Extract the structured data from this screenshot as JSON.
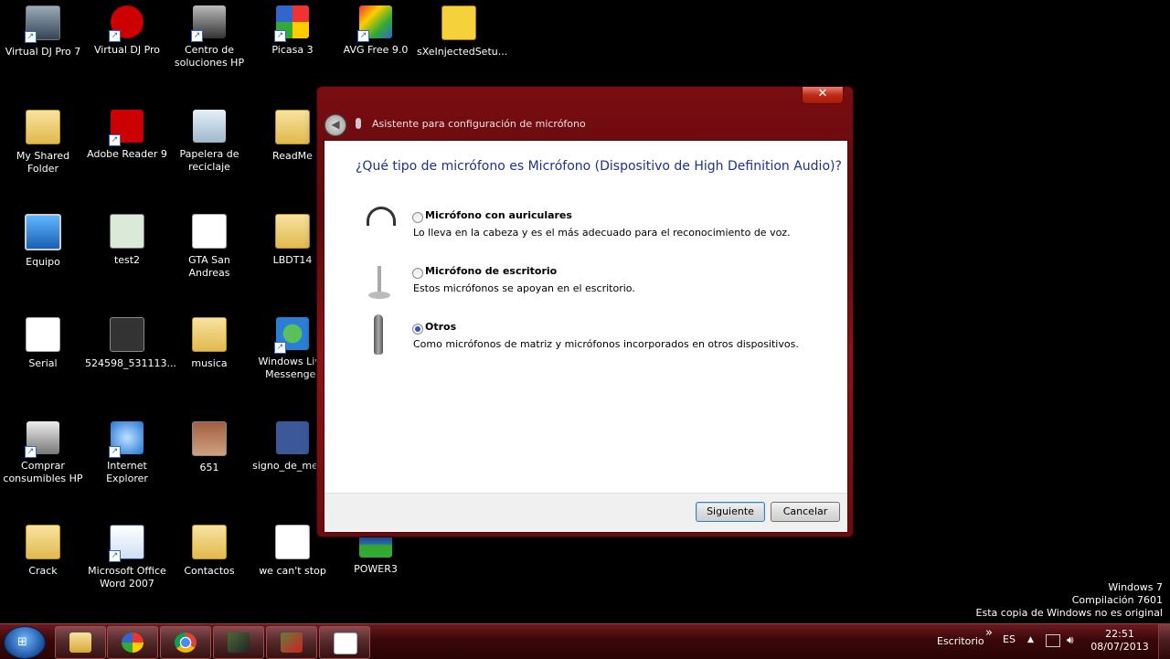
{
  "desktop": {
    "icons": [
      {
        "label": "Virtual DJ Pro 7",
        "icon": "virtual-dj-icon"
      },
      {
        "label": "Virtual DJ Pro",
        "icon": "virtual-dj-icon"
      },
      {
        "label": "Centro de soluciones HP",
        "icon": "hp-icon"
      },
      {
        "label": "Picasa 3",
        "icon": "picasa-icon"
      },
      {
        "label": "AVG Free 9.0",
        "icon": "avg-icon"
      },
      {
        "label": "sXeInjectedSetu...",
        "icon": "sxe-icon"
      },
      {
        "label": "My Shared Folder",
        "icon": "folder-icon"
      },
      {
        "label": "Adobe Reader 9",
        "icon": "adobe-reader-icon"
      },
      {
        "label": "Papelera de reciclaje",
        "icon": "recycle-bin-icon"
      },
      {
        "label": "ReadMe",
        "icon": "folder-icon"
      },
      {
        "label": "Equipo",
        "icon": "computer-icon"
      },
      {
        "label": "test2",
        "icon": "app-icon"
      },
      {
        "label": "GTA San Andreas",
        "icon": "document-icon"
      },
      {
        "label": "LBDT14",
        "icon": "folder-icon"
      },
      {
        "label": "Serial",
        "icon": "text-file-icon"
      },
      {
        "label": "524598_531113...",
        "icon": "photo-icon"
      },
      {
        "label": "musica",
        "icon": "folder-icon"
      },
      {
        "label": "Windows Live Messenger",
        "icon": "messenger-icon"
      },
      {
        "label": "Comprar consumibles HP",
        "icon": "printer-icon"
      },
      {
        "label": "Internet Explorer",
        "icon": "internet-explorer-icon"
      },
      {
        "label": "651",
        "icon": "photo-icon"
      },
      {
        "label": "signo_de_me_...",
        "icon": "like-image-icon"
      },
      {
        "label": "Crack",
        "icon": "folder-icon"
      },
      {
        "label": "Microsoft Office Word 2007",
        "icon": "word-icon"
      },
      {
        "label": "Contactos",
        "icon": "contacts-folder-icon"
      },
      {
        "label": "we can't stop",
        "icon": "mp3-icon"
      },
      {
        "label": "POWER3",
        "icon": "winrar-icon"
      }
    ]
  },
  "dialog": {
    "title": "Asistente para configuración de micrófono",
    "close_label": "✕",
    "question": "¿Qué tipo de micrófono es Micrófono (Dispositivo de High Definition Audio)?",
    "options": [
      {
        "title": "Micrófono con auriculares",
        "description": "Lo lleva en la cabeza y es el más adecuado para el reconocimiento de voz.",
        "selected": false,
        "icon": "headset-icon"
      },
      {
        "title": "Micrófono de escritorio",
        "description": "Estos micrófonos se apoyan en el escritorio.",
        "selected": false,
        "icon": "desktop-microphone-icon"
      },
      {
        "title": "Otros",
        "description": "Como micrófonos de matriz y micrófonos incorporados en otros dispositivos.",
        "selected": true,
        "icon": "handheld-microphone-icon"
      }
    ],
    "next_label": "Siguiente",
    "cancel_label": "Cancelar"
  },
  "watermark": {
    "line1": "Windows 7",
    "line2": "Compilación  7601",
    "line3": "Esta copia de Windows no es original"
  },
  "taskbar": {
    "start_symbol": "⊞",
    "desktop_toolbar_label": "Escritorio",
    "chevron": "»",
    "language": "ES",
    "time": "22:51",
    "date": "08/07/2013"
  },
  "colors": {
    "accent": "#1e3287",
    "window_frame": "#7a0d12",
    "taskbar": "#3a0708"
  }
}
